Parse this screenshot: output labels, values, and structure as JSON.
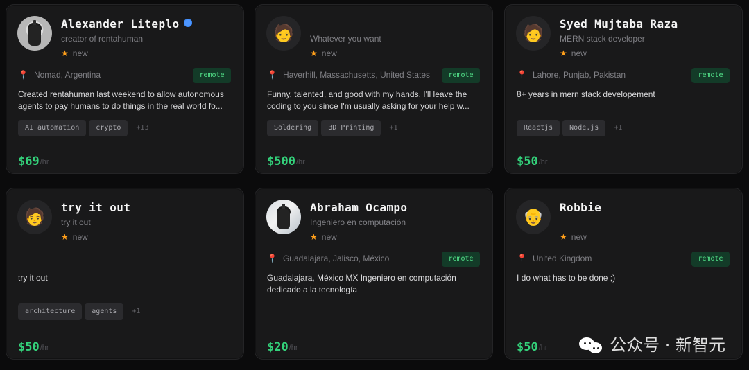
{
  "cards": [
    {
      "name": "Alexander Liteplo",
      "subtitle": "creator of rentahuman",
      "rating": "new",
      "location": "Nomad, Argentina",
      "remote": "remote",
      "description": "Created rentahuman last weekend to allow autonomous agents to pay humans to do things in the real world fo...",
      "tags": [
        "AI automation",
        "crypto"
      ],
      "more_tags": "+13",
      "price": "$69",
      "price_unit": "/hr",
      "avatar_icon": "person-photo-avatar",
      "verified_icon": "verified-badge-icon"
    },
    {
      "name": "",
      "subtitle": "Whatever you want",
      "rating": "new",
      "location": "Haverhill, Massachusetts, United States",
      "remote": "remote",
      "description": "Funny, talented, and good with my hands. I'll leave the coding to you since I'm usually asking for your help w...",
      "tags": [
        "Soldering",
        "3D Printing"
      ],
      "more_tags": "+1",
      "price": "$500",
      "price_unit": "/hr",
      "avatar_icon": "emoji-avatar",
      "avatar_emoji": "🧑"
    },
    {
      "name": "Syed Mujtaba Raza",
      "subtitle": "MERN stack developer",
      "rating": "new",
      "location": "Lahore, Punjab, Pakistan",
      "remote": "remote",
      "description": "8+ years in mern stack developement",
      "tags": [
        "Reactjs",
        "Node.js"
      ],
      "more_tags": "+1",
      "price": "$50",
      "price_unit": "/hr",
      "avatar_icon": "emoji-avatar",
      "avatar_emoji": "🧑"
    },
    {
      "name": "try it out",
      "subtitle": "try it out",
      "rating": "new",
      "location": "",
      "remote": "",
      "description": "try it out",
      "tags": [
        "architecture",
        "agents"
      ],
      "more_tags": "+1",
      "price": "$50",
      "price_unit": "/hr",
      "avatar_icon": "emoji-avatar",
      "avatar_emoji": "🧑"
    },
    {
      "name": "Abraham Ocampo",
      "subtitle": "Ingeniero en computación",
      "rating": "new",
      "location": "Guadalajara, Jalisco, México",
      "remote": "remote",
      "description": "Guadalajara, México MX Ingeniero en computación dedicado a la tecnología",
      "tags": [],
      "more_tags": "",
      "price": "$20",
      "price_unit": "/hr",
      "avatar_icon": "person-photo-avatar"
    },
    {
      "name": "Robbie",
      "subtitle": "",
      "rating": "new",
      "location": "United Kingdom",
      "remote": "remote",
      "description": "I do what has to be done ;)",
      "tags": [],
      "more_tags": "",
      "price": "$50",
      "price_unit": "/hr",
      "avatar_icon": "emoji-avatar",
      "avatar_emoji": "👴"
    }
  ],
  "watermark": {
    "text": "公众号 · 新智元",
    "icon": "wechat-icon"
  },
  "colors": {
    "background": "#0b0b0c",
    "card": "#19191a",
    "green": "#33d17a",
    "orange_star": "#ff9f1a",
    "pin_red": "#ef5b73",
    "remote_bg": "#133b28",
    "verified_blue": "#4d96ff"
  }
}
